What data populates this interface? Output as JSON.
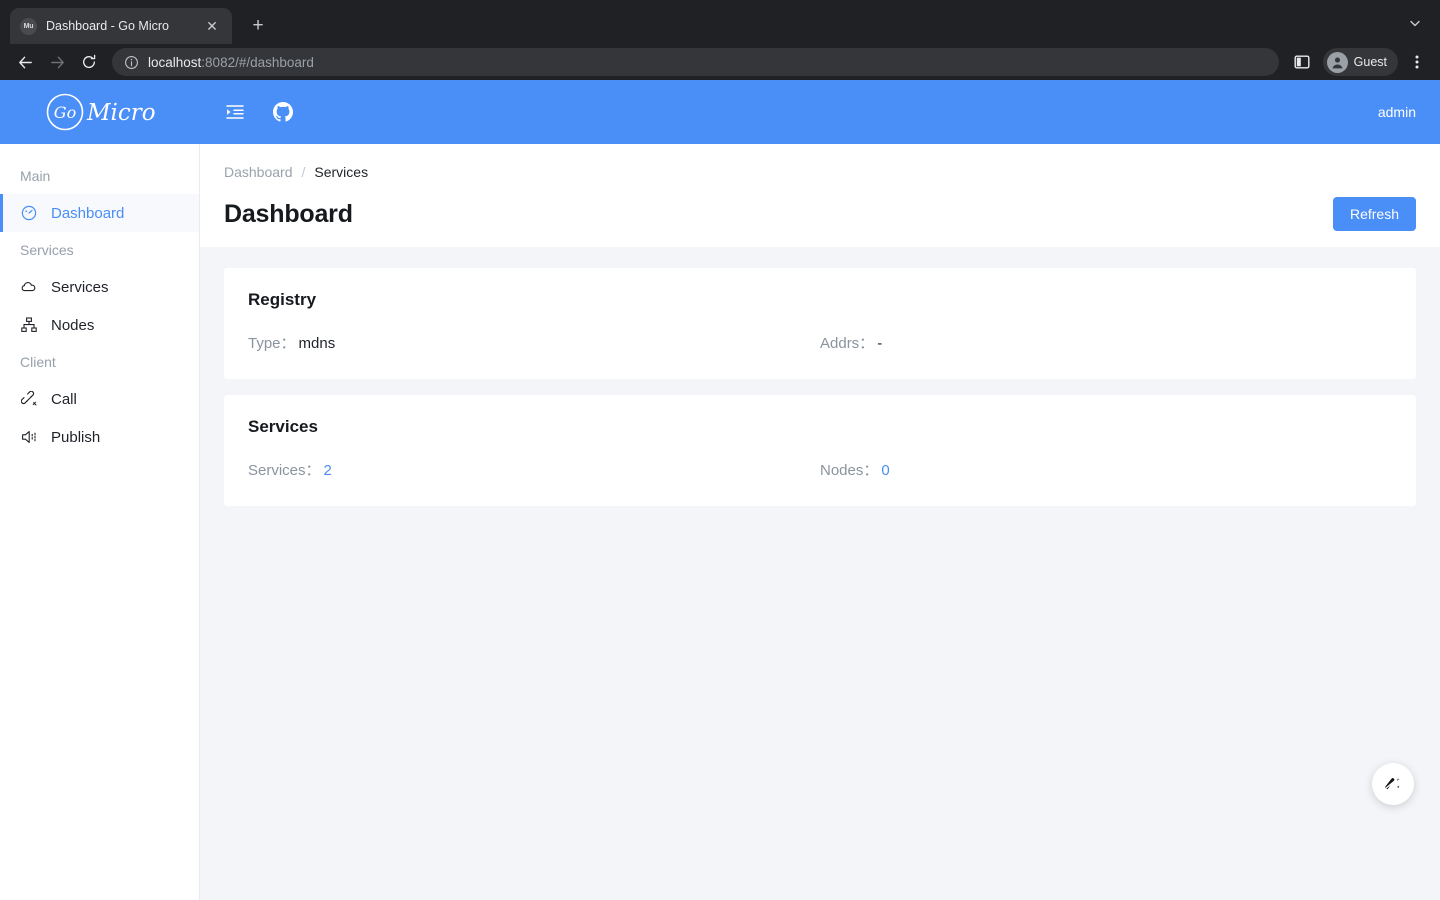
{
  "browser": {
    "tab": {
      "favicon_text": "Mu",
      "title": "Dashboard - Go Micro",
      "close_label": "✕"
    },
    "new_tab_label": "+",
    "tab_list_icon": "chevron-down-icon",
    "nav": {
      "back": "←",
      "forward": "→",
      "reload": "⟳"
    },
    "omnibox": {
      "host": "localhost",
      "rest": ":8082/#/dashboard",
      "info_icon": "info-circle-icon"
    },
    "profile": {
      "name": "Guest"
    },
    "menu_icon": "kebab-menu-icon",
    "side_panel_icon": "side-panel-icon"
  },
  "appbar": {
    "brand_go": "Go",
    "brand_micro": "Micro",
    "menu_fold_icon": "menu-fold-icon",
    "github_icon": "github-icon",
    "user": "admin"
  },
  "sidebar": {
    "groups": [
      {
        "label": "Main",
        "items": [
          {
            "label": "Dashboard",
            "icon": "dashboard-gauge-icon",
            "active": true
          }
        ]
      },
      {
        "label": "Services",
        "items": [
          {
            "label": "Services",
            "icon": "cloud-icon",
            "active": false
          },
          {
            "label": "Nodes",
            "icon": "cluster-icon",
            "active": false
          }
        ]
      },
      {
        "label": "Client",
        "items": [
          {
            "label": "Call",
            "icon": "api-link-icon",
            "active": false
          },
          {
            "label": "Publish",
            "icon": "sound-icon",
            "active": false
          }
        ]
      }
    ]
  },
  "page": {
    "breadcrumb": {
      "parent": "Dashboard",
      "separator": "/",
      "current": "Services"
    },
    "title": "Dashboard",
    "refresh_label": "Refresh"
  },
  "cards": [
    {
      "title": "Registry",
      "fields": [
        {
          "key": "Type：",
          "value": "mdns",
          "accent": false
        },
        {
          "key": "Addrs：",
          "value": "-",
          "accent": false
        }
      ]
    },
    {
      "title": "Services",
      "fields": [
        {
          "key": "Services：",
          "value": "2",
          "accent": true
        },
        {
          "key": "Nodes：",
          "value": "0",
          "accent": true
        }
      ]
    }
  ],
  "fab": {
    "icon": "magic-wand-icon"
  },
  "colors": {
    "accent": "#4a8ef7",
    "content_bg": "#f4f5f9",
    "chrome_bg": "#202124"
  }
}
